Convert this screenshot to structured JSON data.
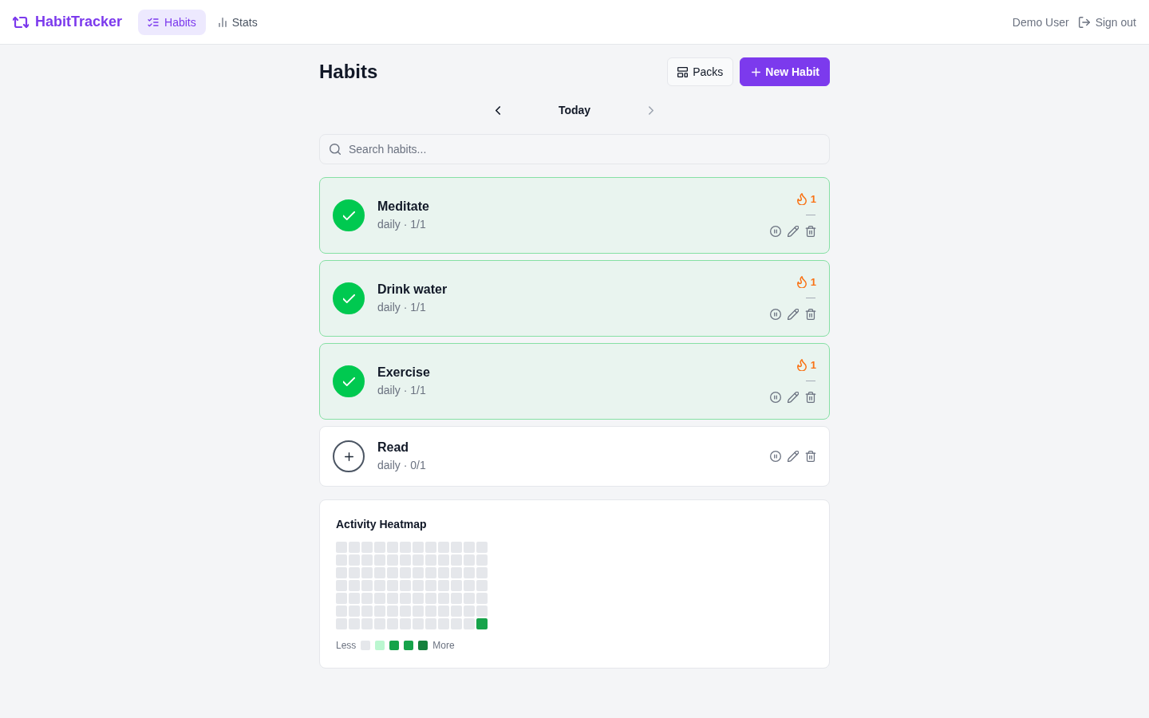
{
  "app": {
    "name": "HabitTracker"
  },
  "nav": [
    {
      "label": "Habits",
      "selected": true
    },
    {
      "label": "Stats",
      "selected": false
    }
  ],
  "user": {
    "name": "Demo User",
    "sign_out": "Sign out"
  },
  "page": {
    "title": "Habits",
    "buttons": [
      {
        "label": "Packs",
        "kind": "secondary"
      },
      {
        "label": "New Habit",
        "kind": "primary"
      }
    ]
  },
  "date_nav": {
    "label": "Today",
    "prev": {
      "disabled": false
    },
    "next": {
      "disabled": true
    }
  },
  "search": {
    "placeholder": "Search habits..."
  },
  "habits": [
    {
      "name": "Meditate",
      "schedule": "daily · 1/1",
      "done": true,
      "streak": "1",
      "streak_note": "—"
    },
    {
      "name": "Drink water",
      "schedule": "daily · 1/1",
      "done": true,
      "streak": "1",
      "streak_note": "—"
    },
    {
      "name": "Exercise",
      "schedule": "daily · 1/1",
      "done": true,
      "streak": "1",
      "streak_note": "—"
    },
    {
      "name": "Read",
      "schedule": "daily · 0/1",
      "done": false
    }
  ],
  "heatmap": {
    "title": "Activity Heatmap",
    "weeks": [
      {
        "days": [
          {
            "color": "#e5e7eb"
          },
          {
            "color": "#e5e7eb"
          },
          {
            "color": "#e5e7eb"
          },
          {
            "color": "#e5e7eb"
          },
          {
            "color": "#e5e7eb"
          },
          {
            "color": "#e5e7eb"
          },
          {
            "color": "#e5e7eb"
          }
        ]
      },
      {
        "days": [
          {
            "color": "#e5e7eb"
          },
          {
            "color": "#e5e7eb"
          },
          {
            "color": "#e5e7eb"
          },
          {
            "color": "#e5e7eb"
          },
          {
            "color": "#e5e7eb"
          },
          {
            "color": "#e5e7eb"
          },
          {
            "color": "#e5e7eb"
          }
        ]
      },
      {
        "days": [
          {
            "color": "#e5e7eb"
          },
          {
            "color": "#e5e7eb"
          },
          {
            "color": "#e5e7eb"
          },
          {
            "color": "#e5e7eb"
          },
          {
            "color": "#e5e7eb"
          },
          {
            "color": "#e5e7eb"
          },
          {
            "color": "#e5e7eb"
          }
        ]
      },
      {
        "days": [
          {
            "color": "#e5e7eb"
          },
          {
            "color": "#e5e7eb"
          },
          {
            "color": "#e5e7eb"
          },
          {
            "color": "#e5e7eb"
          },
          {
            "color": "#e5e7eb"
          },
          {
            "color": "#e5e7eb"
          },
          {
            "color": "#e5e7eb"
          }
        ]
      },
      {
        "days": [
          {
            "color": "#e5e7eb"
          },
          {
            "color": "#e5e7eb"
          },
          {
            "color": "#e5e7eb"
          },
          {
            "color": "#e5e7eb"
          },
          {
            "color": "#e5e7eb"
          },
          {
            "color": "#e5e7eb"
          },
          {
            "color": "#e5e7eb"
          }
        ]
      },
      {
        "days": [
          {
            "color": "#e5e7eb"
          },
          {
            "color": "#e5e7eb"
          },
          {
            "color": "#e5e7eb"
          },
          {
            "color": "#e5e7eb"
          },
          {
            "color": "#e5e7eb"
          },
          {
            "color": "#e5e7eb"
          },
          {
            "color": "#e5e7eb"
          }
        ]
      },
      {
        "days": [
          {
            "color": "#e5e7eb"
          },
          {
            "color": "#e5e7eb"
          },
          {
            "color": "#e5e7eb"
          },
          {
            "color": "#e5e7eb"
          },
          {
            "color": "#e5e7eb"
          },
          {
            "color": "#e5e7eb"
          },
          {
            "color": "#e5e7eb"
          }
        ]
      },
      {
        "days": [
          {
            "color": "#e5e7eb"
          },
          {
            "color": "#e5e7eb"
          },
          {
            "color": "#e5e7eb"
          },
          {
            "color": "#e5e7eb"
          },
          {
            "color": "#e5e7eb"
          },
          {
            "color": "#e5e7eb"
          },
          {
            "color": "#e5e7eb"
          }
        ]
      },
      {
        "days": [
          {
            "color": "#e5e7eb"
          },
          {
            "color": "#e5e7eb"
          },
          {
            "color": "#e5e7eb"
          },
          {
            "color": "#e5e7eb"
          },
          {
            "color": "#e5e7eb"
          },
          {
            "color": "#e5e7eb"
          },
          {
            "color": "#e5e7eb"
          }
        ]
      },
      {
        "days": [
          {
            "color": "#e5e7eb"
          },
          {
            "color": "#e5e7eb"
          },
          {
            "color": "#e5e7eb"
          },
          {
            "color": "#e5e7eb"
          },
          {
            "color": "#e5e7eb"
          },
          {
            "color": "#e5e7eb"
          },
          {
            "color": "#e5e7eb"
          }
        ]
      },
      {
        "days": [
          {
            "color": "#e5e7eb"
          },
          {
            "color": "#e5e7eb"
          },
          {
            "color": "#e5e7eb"
          },
          {
            "color": "#e5e7eb"
          },
          {
            "color": "#e5e7eb"
          },
          {
            "color": "#e5e7eb"
          },
          {
            "color": "#e5e7eb"
          }
        ]
      },
      {
        "days": [
          {
            "color": "#e5e7eb"
          },
          {
            "color": "#e5e7eb"
          },
          {
            "color": "#e5e7eb"
          },
          {
            "color": "#e5e7eb"
          },
          {
            "color": "#e5e7eb"
          },
          {
            "color": "#e5e7eb"
          },
          {
            "color": "#16a34a"
          }
        ]
      }
    ],
    "legend": {
      "less": "Less",
      "more": "More",
      "swatches": [
        {
          "color": "#e5e7eb"
        },
        {
          "color": "#bbf7d0"
        },
        {
          "color": "#16a34a"
        },
        {
          "color": "#16a34a"
        },
        {
          "color": "#15803d"
        }
      ]
    }
  }
}
